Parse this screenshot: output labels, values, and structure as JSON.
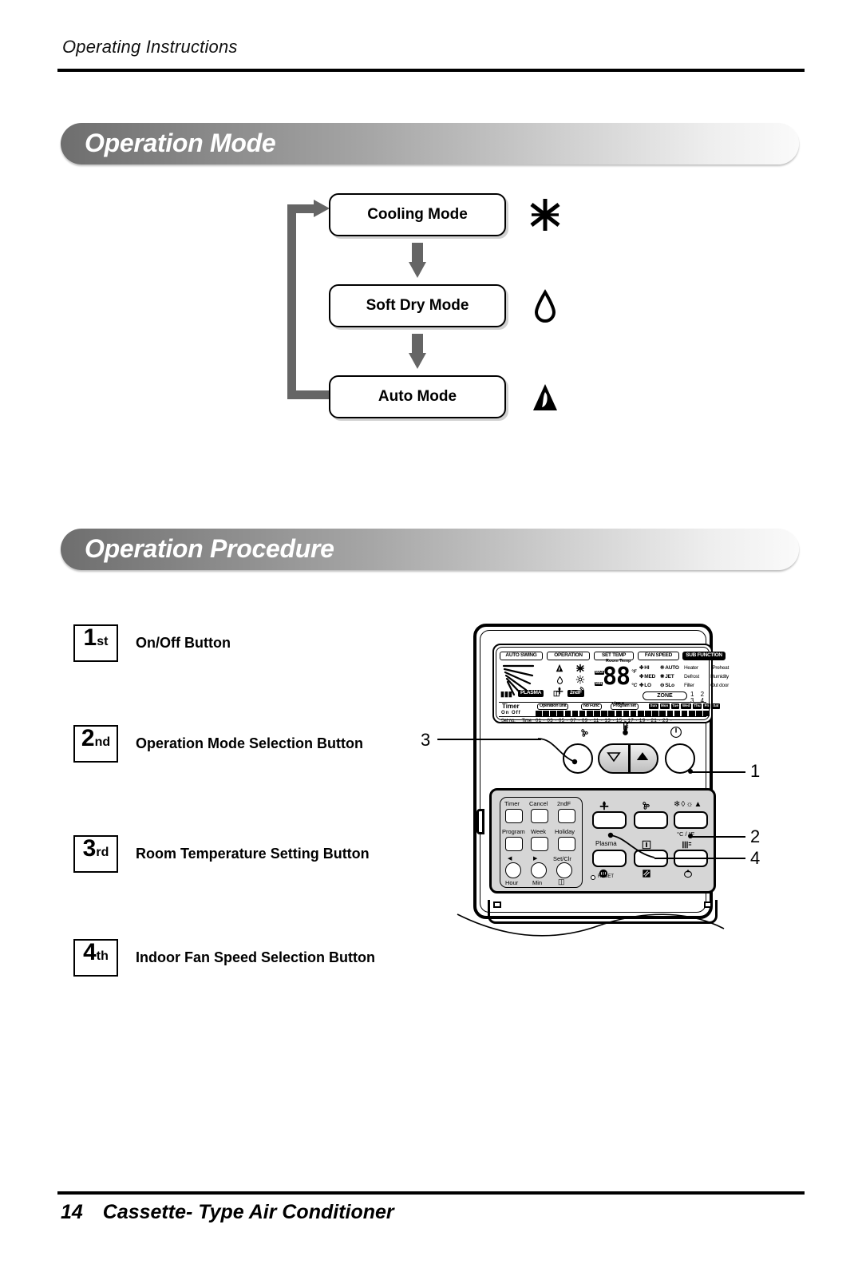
{
  "header": {
    "title": "Operating Instructions"
  },
  "footer": {
    "page_number": "14",
    "document_title": "Cassette- Type Air Conditioner"
  },
  "sections": {
    "operation_mode": {
      "banner": "Operation Mode"
    },
    "operation_procedure": {
      "banner": "Operation Procedure"
    }
  },
  "mode_flow": {
    "boxes": [
      {
        "label": "Cooling Mode",
        "icon": "snowflake-icon"
      },
      {
        "label": "Soft Dry Mode",
        "icon": "water-drop-icon"
      },
      {
        "label": "Auto Mode",
        "icon": "auto-mode-icon"
      }
    ]
  },
  "procedure_steps": [
    {
      "num": "1",
      "suffix": "st",
      "label": "On/Off Button"
    },
    {
      "num": "2",
      "suffix": "nd",
      "label": "Operation Mode Selection Button"
    },
    {
      "num": "3",
      "suffix": "rd",
      "label": "Room Temperature Setting Button"
    },
    {
      "num": "4",
      "suffix": "th",
      "label": "Indoor Fan Speed Selection Button"
    }
  ],
  "callouts": [
    {
      "id": "1",
      "label": "1"
    },
    {
      "id": "2",
      "label": "2"
    },
    {
      "id": "3",
      "label": "3"
    },
    {
      "id": "4",
      "label": "4"
    }
  ],
  "remote": {
    "lcd": {
      "tags": {
        "auto_swing": "AUTO SWING",
        "operation": "OPERATION",
        "set_temp": "SET TEMP",
        "fan_speed": "FAN SPEED",
        "sub_function": "SUB FUNCTION"
      },
      "set_temp": {
        "room_temp_label": "Room Temp",
        "digits": "88",
        "unit_f": "°F",
        "unit_c": "°C",
        "max_tag": "MAX",
        "min_tag": "MIN",
        "time_label": "Time"
      },
      "fan_speed": {
        "items": [
          "HI",
          "AUTO",
          "MED",
          "JET",
          "LO",
          "SLo"
        ],
        "zone_label": "ZONE",
        "zone_numbers": "1 2 3 4"
      },
      "sub_function": {
        "items": [
          "Heater",
          "Preheat",
          "Defrost",
          "Humidity",
          "Filter",
          "Out door"
        ]
      },
      "badges": {
        "plasma": "PLASMA",
        "second_function": "2ndF"
      },
      "timer": {
        "title": "Timer",
        "on_off": "On  Off",
        "pills": [
          "Operation unit",
          "No Func",
          "Program set"
        ],
        "days": [
          "Sun",
          "Mon",
          "Tue",
          "Wed",
          "Thu",
          "Fri",
          "Sat"
        ],
        "set_no_label": "Set no.",
        "time_label": "Time",
        "time_scale": "01 · 03 · 05 · 07 · 09 · 11 · 13 · 15 · 17 · 19 · 21 · 23 ·"
      }
    },
    "control_row": {
      "fan_button_icon": "fan-speed-icon",
      "thermometer_icon": "thermometer-icon",
      "power_icon": "power-icon",
      "temp_down_icon": "triangle-down-icon",
      "temp_up_icon": "triangle-up-icon"
    },
    "keypad": {
      "left_keys": [
        {
          "label": "Timer"
        },
        {
          "label": "Cancel"
        },
        {
          "label": "2ndF"
        },
        {
          "label": "Program"
        },
        {
          "label": "Week"
        },
        {
          "label": "Holiday"
        }
      ],
      "round_keys": [
        {
          "label": "Hour",
          "top_icon": "◀"
        },
        {
          "label": "Min",
          "top_icon": "▶"
        },
        {
          "label": "Set/Clr",
          "top_icon": ""
        }
      ],
      "right_keys": [
        {
          "top_icon": "jet-icon",
          "label": ""
        },
        {
          "top_icon": "fan-icon",
          "label": ""
        },
        {
          "top_icon": "mode-icons",
          "label": "°C / °F"
        },
        {
          "top_icon": "",
          "label": "Plasma"
        },
        {
          "top_icon": "room-temp-icon",
          "label": ""
        },
        {
          "top_icon": "swing-icon",
          "label": ""
        }
      ],
      "reset_label": "RESET"
    }
  }
}
